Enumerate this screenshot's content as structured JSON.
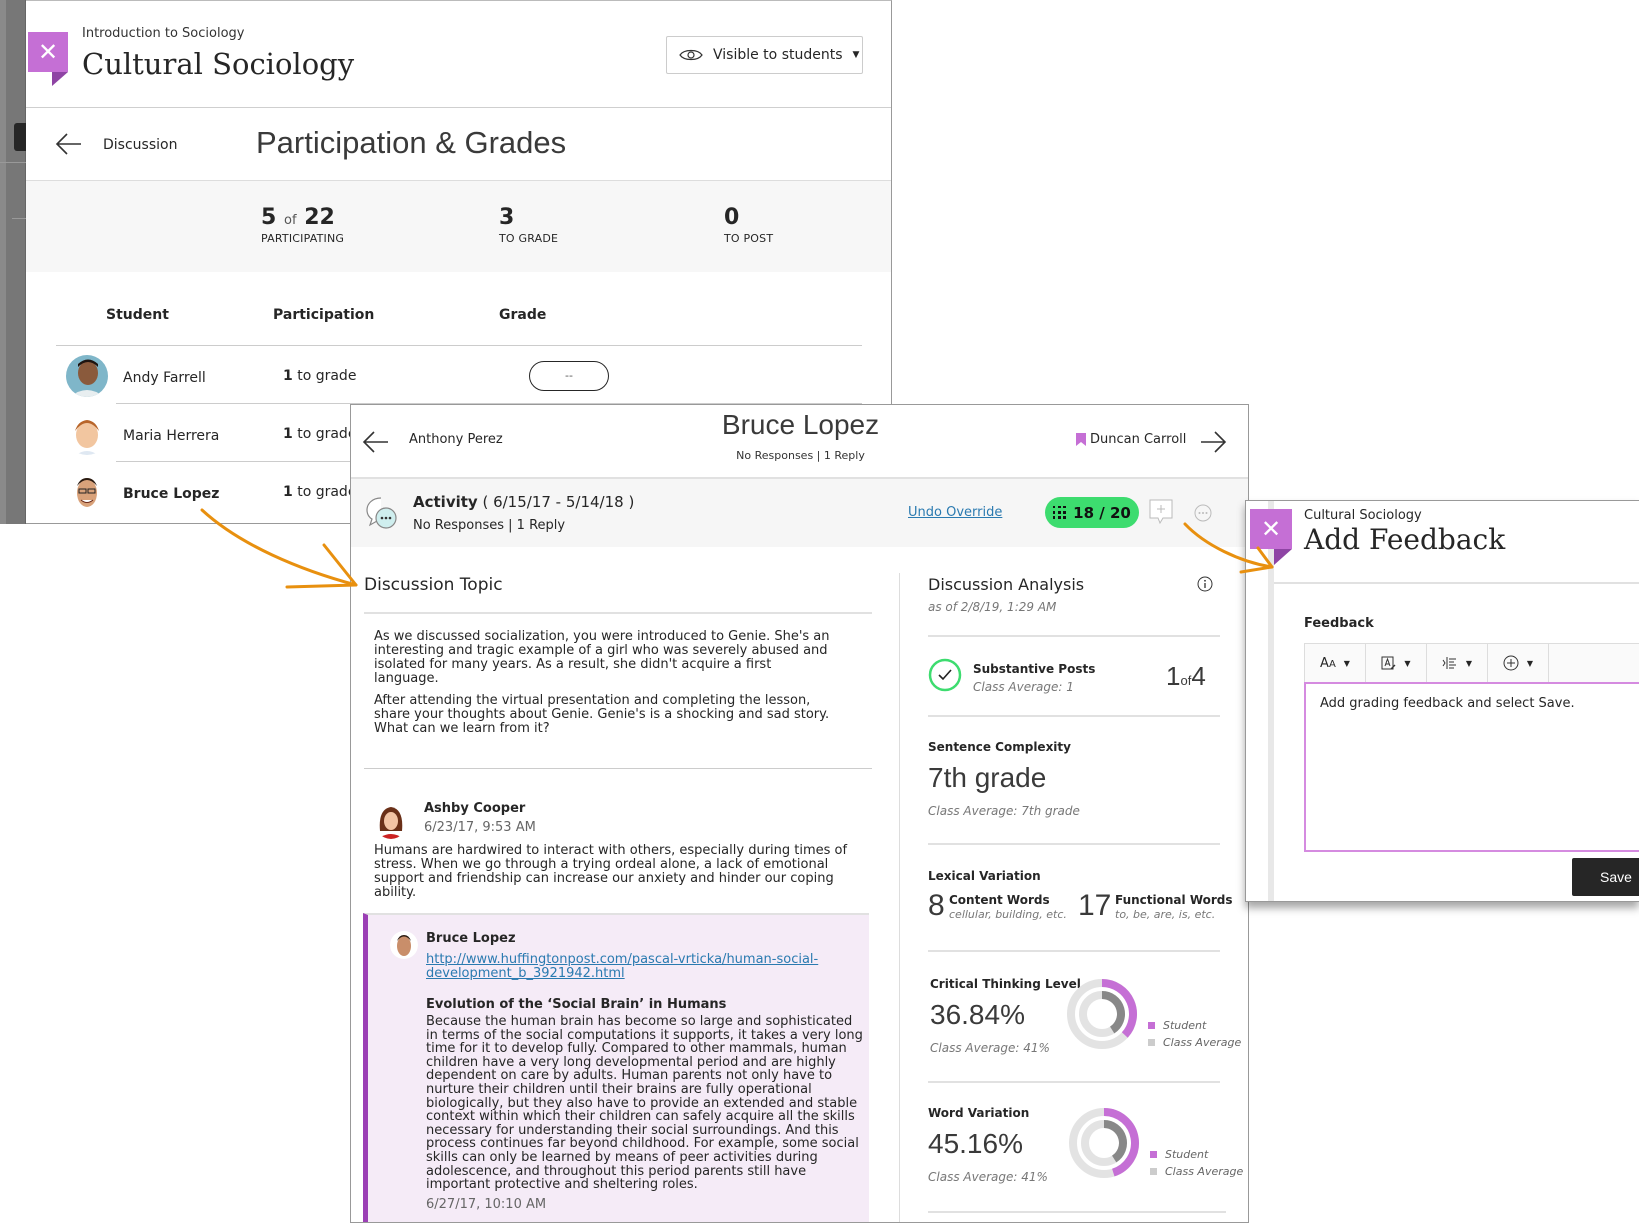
{
  "participation_panel": {
    "course_label": "Introduction to Sociology",
    "course_title": "Cultural Sociology",
    "visibility": "Visible to students",
    "breadcrumb": "Discussion",
    "heading": "Participation & Grades",
    "stats": {
      "participating_num": "5",
      "participating_of": "of",
      "participating_total": "22",
      "participating_label": "PARTICIPATING",
      "to_grade_num": "3",
      "to_grade_label": "TO GRADE",
      "to_post_num": "0",
      "to_post_label": "TO POST"
    },
    "columns": [
      "Student",
      "Participation",
      "Grade"
    ],
    "students": [
      {
        "name": "Andy Farrell",
        "count": "1",
        "status": "to grade",
        "grade": "--"
      },
      {
        "name": "Maria Herrera",
        "count": "1",
        "status": "to grade"
      },
      {
        "name": "Bruce Lopez",
        "count": "1",
        "status": "to grade"
      }
    ]
  },
  "student_panel": {
    "prev_student": "Anthony Perez",
    "student_name": "Bruce Lopez",
    "student_summary": "No Responses | 1 Reply",
    "next_student": "Duncan Carroll",
    "activity": {
      "label": "Activity",
      "dates": "( 6/15/17 - 5/14/18 )",
      "summary": "No Responses | 1 Reply",
      "undo_label": "Undo Override",
      "grade": "18 / 20"
    },
    "topic": {
      "heading": "Discussion Topic",
      "paragraph1": "As we discussed socialization, you were introduced to Genie. She's an interesting and tragic example of a girl who was severely abused and isolated for many years. As a result, she didn't acquire a first language.",
      "paragraph2": "After attending the virtual presentation and completing the lesson, share your thoughts about Genie. Genie's is a shocking and sad story. What can we learn from it?"
    },
    "posts": [
      {
        "author": "Ashby Cooper",
        "date": "6/23/17, 9:53 AM",
        "body": "Humans are hardwired to interact with others, especially during times of stress. When we go through a trying ordeal alone, a lack of emotional support and friendship can increase our anxiety and hinder our coping ability."
      }
    ],
    "reply": {
      "author": "Bruce Lopez",
      "link": "http://www.huffingtonpost.com/pascal-vrticka/human-social-development_b_3921942.html",
      "title": "Evolution of the ‘Social Brain’ in Humans",
      "body": "Because the human brain has become so large and sophisticated in terms of the social computations it supports, it takes a very long time for it to develop fully. Compared to other mammals, human children have a very long developmental period and are highly dependent on care by adults. Human parents not only have to nurture their children until their brains are fully operational biologically, but they also have to provide an extended and stable context within which their children can safely acquire all the skills necessary for understanding their social surroundings. And this process continues far beyond childhood. For example, some social skills can only be learned by means of peer activities during adolescence, and throughout this period parents still have important protective and sheltering roles.",
      "date": "6/27/17, 10:10 AM"
    },
    "analysis": {
      "heading": "Discussion Analysis",
      "as_of": "as of 2/8/19, 1:29 AM",
      "substantive": {
        "label": "Substantive Posts",
        "class_avg": "Class Average: 1",
        "value": "1",
        "of": "of",
        "total": "4"
      },
      "sentence": {
        "label": "Sentence Complexity",
        "value": "7th grade",
        "class_avg": "Class Average: 7th grade"
      },
      "lexical": {
        "label": "Lexical Variation",
        "content_count": "8",
        "content_label": "Content Words",
        "content_examples": "cellular, building, etc.",
        "functional_count": "17",
        "functional_label": "Functional Words",
        "functional_examples": "to, be, are, is, etc."
      },
      "critical": {
        "label": "Critical Thinking Level",
        "value": "36.84%",
        "class_avg": "Class Average: 41%",
        "student_pct": 36.84,
        "class_pct": 41
      },
      "word_var": {
        "label": "Word Variation",
        "value": "45.16%",
        "class_avg": "Class Average: 41%",
        "student_pct": 45.16,
        "class_pct": 41
      },
      "legend_student": "Student",
      "legend_class": "Class Average"
    }
  },
  "feedback_panel": {
    "course": "Cultural Sociology",
    "title": "Add Feedback",
    "field_label": "Feedback",
    "editor_text": "Add grading feedback and select Save.",
    "save_label": "Save",
    "toolbar": [
      "text-size",
      "text-style",
      "list-indent",
      "insert"
    ]
  },
  "colors": {
    "accent_purple": "#c56fd5",
    "grade_green": "#3ddc6f",
    "link_blue": "#2a7ab0",
    "reply_bg": "#f5ebf7",
    "donut_student": "#c56fd5",
    "donut_class": "#888888",
    "arrow_orange": "#e8900f"
  }
}
